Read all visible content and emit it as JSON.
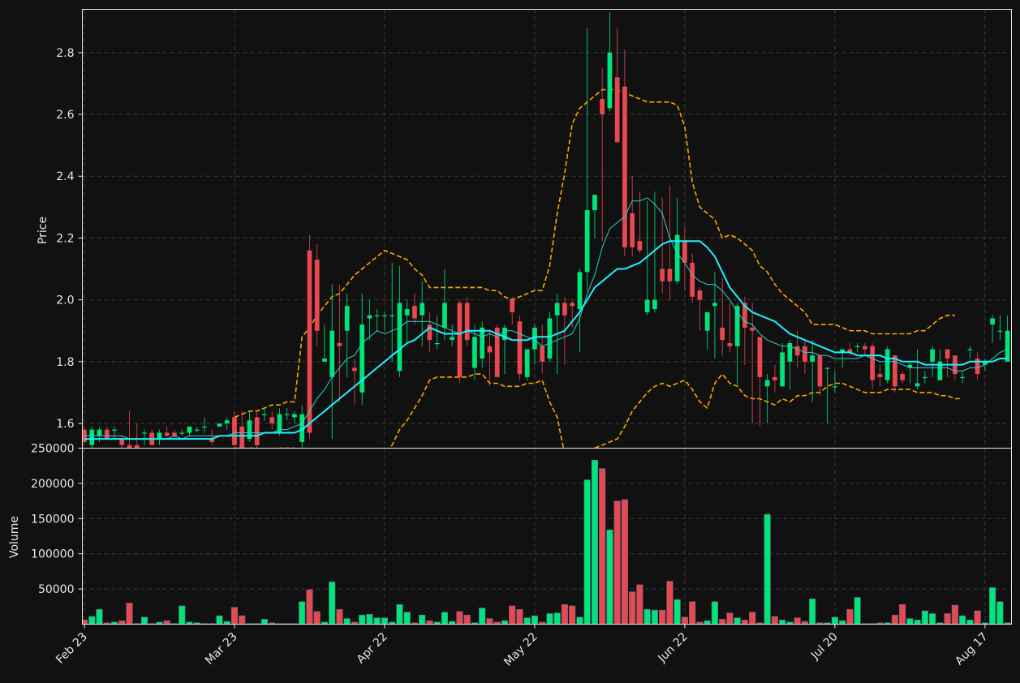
{
  "chart_data": {
    "type": "candlestick",
    "colors": {
      "background": "#111111",
      "grid": "#3a3a3a",
      "axis": "#e8e8e8",
      "up": "#00e57a",
      "down": "#e84850",
      "ma_fast": "#2fd0d0",
      "ma_slow": "#1ff0ff",
      "band": "#ffa500"
    },
    "price_panel": {
      "ylabel": "Price",
      "ylim": [
        1.52,
        2.94
      ],
      "yticks": [
        "1.6",
        "1.8",
        "2.0",
        "2.2",
        "2.4",
        "2.6",
        "2.8"
      ],
      "grid": true
    },
    "volume_panel": {
      "ylabel": "Volume",
      "ylim": [
        0,
        250000
      ],
      "yticks": [
        "50000",
        "100000",
        "150000",
        "200000",
        "250000"
      ],
      "grid": true
    },
    "x_ticks": [
      {
        "index": 0,
        "label": "Feb 23"
      },
      {
        "index": 20,
        "label": "Mar 23"
      },
      {
        "index": 40,
        "label": "Apr 22"
      },
      {
        "index": 60,
        "label": "May 22"
      },
      {
        "index": 80,
        "label": "Jun 22"
      },
      {
        "index": 100,
        "label": "Jul 20"
      },
      {
        "index": 120,
        "label": "Aug 17"
      }
    ],
    "open": [
      1.58,
      1.53,
      1.56,
      1.58,
      1.58,
      1.55,
      1.53,
      1.53,
      1.57,
      1.57,
      1.55,
      1.57,
      1.57,
      1.57,
      1.57,
      1.58,
      1.59,
      1.55,
      1.59,
      1.6,
      1.62,
      1.59,
      1.55,
      1.62,
      1.63,
      1.62,
      1.57,
      1.63,
      1.62,
      1.54,
      2.16,
      2.13,
      1.8,
      1.75,
      1.86,
      1.9,
      1.78,
      1.7,
      1.94,
      1.95,
      1.95,
      1.95,
      1.77,
      1.95,
      1.98,
      1.95,
      1.92,
      1.86,
      1.91,
      1.87,
      1.99,
      1.99,
      1.78,
      1.81,
      1.85,
      1.91,
      1.87,
      2.0,
      1.93,
      1.75,
      1.84,
      1.85,
      1.81,
      1.95,
      1.99,
      1.99,
      1.97,
      2.09,
      2.29,
      2.65,
      2.62,
      2.72,
      2.69,
      2.28,
      2.19,
      1.96,
      1.97,
      2.1,
      2.1,
      2.06,
      2.19,
      2.12,
      2.03,
      1.9,
      1.98,
      1.91,
      1.86,
      1.85,
      1.99,
      1.91,
      1.88,
      1.72,
      1.75,
      1.72,
      1.8,
      1.85,
      1.85,
      1.8,
      1.82,
      1.78,
      1.72,
      1.83,
      1.84,
      1.85,
      1.85,
      1.85,
      1.76,
      1.74,
      1.82,
      1.76,
      1.78,
      1.72,
      1.75,
      1.8,
      1.74,
      1.84,
      1.82,
      1.75,
      1.84,
      1.81,
      1.79,
      1.92,
      1.9,
      1.8
    ],
    "close": [
      1.54,
      1.58,
      1.58,
      1.55,
      1.58,
      1.53,
      1.52,
      1.52,
      1.57,
      1.53,
      1.57,
      1.56,
      1.56,
      1.57,
      1.59,
      1.58,
      1.59,
      1.54,
      1.6,
      1.61,
      1.53,
      1.52,
      1.61,
      1.53,
      1.63,
      1.6,
      1.63,
      1.63,
      1.63,
      1.63,
      1.57,
      1.9,
      1.81,
      1.9,
      1.85,
      1.98,
      1.77,
      1.92,
      1.95,
      1.95,
      1.95,
      1.95,
      1.99,
      1.97,
      1.94,
      1.99,
      1.87,
      1.86,
      1.99,
      1.88,
      1.75,
      1.87,
      1.88,
      1.91,
      1.83,
      1.75,
      1.91,
      1.96,
      1.76,
      1.84,
      1.91,
      1.8,
      1.94,
      1.99,
      1.95,
      1.98,
      2.09,
      2.29,
      2.34,
      2.6,
      2.8,
      2.51,
      2.17,
      2.17,
      2.16,
      2.0,
      2.0,
      2.06,
      2.06,
      2.21,
      2.12,
      2.01,
      2.0,
      1.96,
      1.99,
      1.87,
      1.85,
      1.98,
      1.91,
      1.9,
      1.75,
      1.74,
      1.74,
      1.83,
      1.86,
      1.82,
      1.8,
      1.82,
      1.72,
      1.78,
      1.72,
      1.84,
      1.83,
      1.85,
      1.84,
      1.74,
      1.75,
      1.84,
      1.72,
      1.74,
      1.79,
      1.73,
      1.75,
      1.84,
      1.8,
      1.81,
      1.76,
      1.75,
      1.84,
      1.76,
      1.8,
      1.94,
      1.9,
      1.9
    ],
    "high": [
      1.59,
      1.59,
      1.59,
      1.59,
      1.59,
      1.56,
      1.64,
      1.6,
      1.58,
      1.58,
      1.58,
      1.59,
      1.58,
      1.58,
      1.59,
      1.59,
      1.62,
      1.58,
      1.6,
      1.62,
      1.64,
      1.64,
      1.64,
      1.64,
      1.65,
      1.64,
      1.65,
      1.65,
      1.64,
      1.66,
      2.21,
      2.18,
      1.92,
      2.05,
      2.05,
      2.02,
      1.81,
      2.02,
      2.0,
      1.97,
      1.96,
      2.12,
      2.11,
      2.0,
      2.02,
      2.06,
      1.96,
      1.95,
      2.1,
      1.92,
      2.0,
      2.01,
      1.92,
      1.93,
      1.9,
      1.92,
      1.92,
      2.01,
      1.95,
      1.77,
      1.92,
      1.92,
      1.96,
      2.02,
      2.01,
      2.0,
      2.1,
      2.88,
      2.34,
      2.75,
      2.93,
      2.88,
      2.81,
      2.4,
      2.35,
      2.32,
      2.35,
      2.33,
      2.37,
      2.33,
      2.24,
      2.15,
      2.04,
      1.96,
      2.09,
      2.07,
      1.99,
      1.99,
      2.01,
      1.99,
      1.8,
      1.76,
      1.79,
      1.86,
      1.87,
      1.9,
      1.87,
      1.87,
      1.78,
      1.78,
      1.77,
      1.84,
      1.86,
      1.86,
      1.86,
      1.86,
      1.79,
      1.85,
      1.81,
      1.77,
      1.8,
      1.84,
      1.77,
      1.85,
      1.84,
      1.83,
      1.81,
      1.77,
      1.85,
      1.83,
      1.81,
      1.95,
      1.95,
      1.95
    ],
    "low": [
      1.53,
      1.52,
      1.54,
      1.55,
      1.55,
      1.52,
      1.52,
      1.51,
      1.53,
      1.53,
      1.53,
      1.55,
      1.55,
      1.56,
      1.56,
      1.57,
      1.57,
      1.53,
      1.59,
      1.58,
      1.52,
      1.52,
      1.54,
      1.51,
      1.61,
      1.58,
      1.56,
      1.61,
      1.6,
      1.52,
      1.55,
      1.85,
      1.8,
      1.55,
      1.67,
      1.75,
      1.66,
      1.66,
      1.87,
      1.9,
      1.9,
      1.8,
      1.75,
      1.86,
      1.92,
      1.85,
      1.83,
      1.84,
      1.87,
      1.85,
      1.73,
      1.85,
      1.74,
      1.78,
      1.72,
      1.76,
      1.76,
      1.92,
      1.74,
      1.74,
      1.79,
      1.76,
      1.8,
      1.76,
      1.79,
      1.91,
      1.83,
      2.03,
      2.2,
      2.19,
      2.61,
      2.54,
      2.14,
      2.14,
      2.15,
      1.95,
      1.96,
      2.02,
      2.0,
      2.05,
      2.03,
      1.99,
      1.9,
      1.84,
      1.81,
      1.82,
      1.83,
      1.72,
      1.79,
      1.6,
      1.59,
      1.6,
      1.7,
      1.78,
      1.71,
      1.78,
      1.76,
      1.67,
      1.69,
      1.6,
      1.7,
      1.78,
      1.82,
      1.83,
      1.82,
      1.71,
      1.72,
      1.73,
      1.7,
      1.73,
      1.73,
      1.71,
      1.73,
      1.75,
      1.76,
      1.75,
      1.74,
      1.73,
      1.81,
      1.74,
      1.77,
      1.86,
      1.87,
      1.86
    ],
    "volume": [
      6000,
      11000,
      21000,
      2000,
      3000,
      5000,
      30000,
      1000,
      10000,
      1000,
      3000,
      5000,
      1000,
      26000,
      3000,
      2000,
      1000,
      1000,
      12000,
      4000,
      24000,
      12000,
      1000,
      1000,
      7000,
      2000,
      1000,
      1000,
      1000,
      32000,
      49000,
      18000,
      3000,
      60000,
      21000,
      8000,
      3000,
      13000,
      14000,
      9000,
      9000,
      3000,
      28000,
      17000,
      2000,
      13000,
      5000,
      3000,
      17000,
      4000,
      18000,
      13000,
      2000,
      23000,
      8000,
      3000,
      5000,
      26000,
      21000,
      9000,
      12000,
      3000,
      15000,
      16000,
      28000,
      26000,
      10000,
      205000,
      233000,
      221000,
      134000,
      175000,
      177000,
      46000,
      56000,
      21000,
      20000,
      20000,
      61000,
      35000,
      10000,
      32000,
      3000,
      5000,
      32000,
      7000,
      16000,
      9000,
      6000,
      17000,
      2000,
      156000,
      11000,
      6000,
      3000,
      9000,
      4000,
      36000,
      2000,
      2000,
      10000,
      5000,
      21000,
      38000,
      1000,
      1000,
      2000,
      2000,
      13000,
      28000,
      8000,
      6000,
      19000,
      15000,
      2000,
      15000,
      27000,
      12000,
      6000,
      19000,
      2000,
      52000,
      32000,
      2000,
      33000
    ],
    "ma_fast": [
      1.56,
      1.56,
      1.56,
      1.56,
      1.56,
      1.56,
      1.55,
      1.55,
      1.55,
      1.55,
      1.55,
      1.55,
      1.56,
      1.55,
      1.56,
      1.56,
      1.56,
      1.56,
      1.56,
      1.56,
      1.57,
      1.57,
      1.57,
      1.57,
      1.57,
      1.57,
      1.58,
      1.58,
      1.59,
      1.6,
      1.64,
      1.68,
      1.71,
      1.75,
      1.78,
      1.81,
      1.82,
      1.86,
      1.88,
      1.9,
      1.89,
      1.9,
      1.91,
      1.93,
      1.93,
      1.93,
      1.93,
      1.92,
      1.91,
      1.9,
      1.89,
      1.9,
      1.89,
      1.88,
      1.89,
      1.88,
      1.9,
      1.9,
      1.89,
      1.88,
      1.87,
      1.85,
      1.86,
      1.87,
      1.88,
      1.89,
      1.94,
      2.02,
      2.08,
      2.17,
      2.23,
      2.25,
      2.27,
      2.32,
      2.32,
      2.33,
      2.31,
      2.28,
      2.2,
      2.15,
      2.12,
      2.08,
      2.06,
      2.05,
      2.05,
      2.03,
      2.0,
      1.96,
      1.93,
      1.92,
      1.89,
      1.87,
      1.86,
      1.85,
      1.85,
      1.84,
      1.83,
      1.83,
      1.82,
      1.82,
      1.81,
      1.81,
      1.81,
      1.81,
      1.82,
      1.81,
      1.8,
      1.8,
      1.8,
      1.79,
      1.78,
      1.78,
      1.78,
      1.78,
      1.78,
      1.78,
      1.77,
      1.77,
      1.78,
      1.78,
      1.79,
      1.81,
      1.83,
      1.84
    ],
    "ma_slow": [
      1.55,
      1.55,
      1.55,
      1.55,
      1.55,
      1.55,
      1.55,
      1.55,
      1.55,
      1.55,
      1.55,
      1.55,
      1.55,
      1.55,
      1.55,
      1.55,
      1.55,
      1.55,
      1.56,
      1.56,
      1.56,
      1.56,
      1.56,
      1.56,
      1.57,
      1.57,
      1.57,
      1.57,
      1.57,
      1.58,
      1.6,
      1.62,
      1.64,
      1.66,
      1.68,
      1.7,
      1.72,
      1.74,
      1.76,
      1.78,
      1.8,
      1.82,
      1.84,
      1.86,
      1.87,
      1.89,
      1.91,
      1.9,
      1.89,
      1.89,
      1.89,
      1.9,
      1.9,
      1.9,
      1.9,
      1.89,
      1.88,
      1.87,
      1.87,
      1.87,
      1.88,
      1.88,
      1.88,
      1.89,
      1.9,
      1.93,
      1.96,
      2.0,
      2.04,
      2.06,
      2.08,
      2.1,
      2.1,
      2.11,
      2.12,
      2.14,
      2.16,
      2.18,
      2.19,
      2.19,
      2.19,
      2.19,
      2.19,
      2.17,
      2.14,
      2.09,
      2.04,
      2.01,
      1.98,
      1.96,
      1.95,
      1.94,
      1.93,
      1.91,
      1.89,
      1.88,
      1.87,
      1.86,
      1.85,
      1.84,
      1.83,
      1.83,
      1.83,
      1.82,
      1.82,
      1.82,
      1.82,
      1.81,
      1.81,
      1.8,
      1.8,
      1.8,
      1.79,
      1.79,
      1.79,
      1.79,
      1.79,
      1.79,
      1.8,
      1.8,
      1.8,
      1.8,
      1.81,
      1.81
    ],
    "bb_upper": [
      null,
      null,
      null,
      null,
      null,
      null,
      null,
      null,
      null,
      null,
      null,
      null,
      null,
      null,
      null,
      null,
      null,
      null,
      null,
      null,
      1.62,
      1.63,
      1.64,
      1.64,
      1.65,
      1.66,
      1.66,
      1.67,
      1.67,
      1.88,
      1.91,
      1.95,
      1.98,
      2.01,
      2.02,
      2.05,
      2.08,
      2.1,
      2.12,
      2.14,
      2.16,
      2.15,
      2.14,
      2.13,
      2.1,
      2.08,
      2.04,
      2.04,
      2.04,
      2.04,
      2.04,
      2.04,
      2.04,
      2.04,
      2.03,
      2.03,
      2.01,
      2.0,
      2.01,
      2.02,
      2.03,
      2.03,
      2.11,
      2.28,
      2.41,
      2.57,
      2.62,
      2.64,
      2.66,
      2.68,
      2.68,
      2.68,
      2.67,
      2.66,
      2.65,
      2.64,
      2.64,
      2.64,
      2.64,
      2.63,
      2.56,
      2.38,
      2.3,
      2.28,
      2.26,
      2.2,
      2.21,
      2.2,
      2.18,
      2.16,
      2.11,
      2.09,
      2.05,
      2.02,
      2.0,
      1.98,
      1.96,
      1.92,
      1.92,
      1.92,
      1.92,
      1.91,
      1.9,
      1.9,
      1.9,
      1.89,
      1.89,
      1.89,
      1.89,
      1.89,
      1.89,
      1.9,
      1.9,
      1.92,
      1.94,
      1.95,
      1.95
    ],
    "bb_lower": [
      null,
      null,
      null,
      null,
      null,
      null,
      null,
      null,
      null,
      null,
      null,
      null,
      null,
      null,
      null,
      null,
      null,
      null,
      null,
      null,
      1.52,
      1.52,
      1.52,
      1.52,
      1.51,
      1.51,
      1.52,
      1.52,
      1.52,
      1.28,
      1.29,
      1.3,
      1.31,
      1.32,
      1.34,
      1.36,
      1.39,
      1.42,
      1.45,
      1.48,
      1.5,
      1.53,
      1.58,
      1.61,
      1.65,
      1.69,
      1.74,
      1.75,
      1.75,
      1.75,
      1.75,
      1.75,
      1.76,
      1.76,
      1.73,
      1.73,
      1.72,
      1.72,
      1.72,
      1.73,
      1.73,
      1.74,
      1.67,
      1.62,
      1.5,
      1.38,
      1.49,
      1.5,
      1.52,
      1.53,
      1.54,
      1.55,
      1.59,
      1.64,
      1.67,
      1.7,
      1.72,
      1.73,
      1.72,
      1.73,
      1.74,
      1.71,
      1.67,
      1.65,
      1.73,
      1.76,
      1.73,
      1.72,
      1.69,
      1.68,
      1.68,
      1.67,
      1.66,
      1.68,
      1.67,
      1.69,
      1.69,
      1.7,
      1.7,
      1.72,
      1.73,
      1.73,
      1.72,
      1.71,
      1.7,
      1.7,
      1.7,
      1.71,
      1.71,
      1.71,
      1.71,
      1.7,
      1.7,
      1.7,
      1.69,
      1.69,
      1.68,
      1.68
    ]
  }
}
